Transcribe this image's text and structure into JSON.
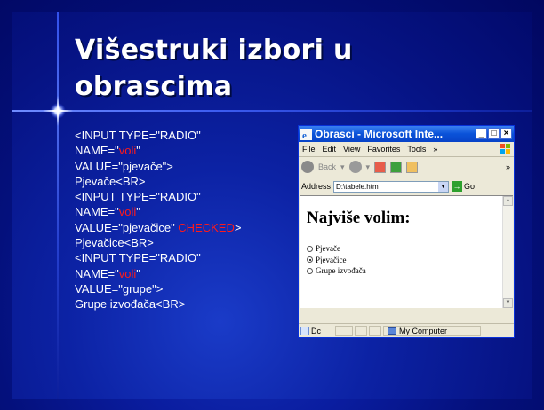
{
  "slide": {
    "title_line1": "Višestruki izbori u",
    "title_line2": "obrascima",
    "code_lines": [
      [
        {
          "t": "<INPUT TYPE=\"RADIO\""
        }
      ],
      [
        {
          "t": "NAME=\""
        },
        {
          "t": "voli",
          "red": true
        },
        {
          "t": "\""
        }
      ],
      [
        {
          "t": "VALUE=\"pjevače\">"
        }
      ],
      [
        {
          "t": "Pjevače<BR>"
        }
      ],
      [
        {
          "t": "<INPUT TYPE=\"RADIO\""
        }
      ],
      [
        {
          "t": "NAME=\""
        },
        {
          "t": "voli",
          "red": true
        },
        {
          "t": "\""
        }
      ],
      [
        {
          "t": "VALUE=\"pjevačice\" "
        },
        {
          "t": "CHECKED",
          "red": true
        },
        {
          "t": ">"
        }
      ],
      [
        {
          "t": "Pjevačice<BR>"
        }
      ],
      [
        {
          "t": "<INPUT TYPE=\"RADIO\""
        }
      ],
      [
        {
          "t": "NAME=\""
        },
        {
          "t": "voli",
          "red": true
        },
        {
          "t": "\""
        }
      ],
      [
        {
          "t": "VALUE=\"grupe\">"
        }
      ],
      [
        {
          "t": "Grupe izvođača<BR>"
        }
      ]
    ]
  },
  "browser": {
    "window_title": "Obrasci - Microsoft Inte...",
    "menu": [
      "File",
      "Edit",
      "View",
      "Favorites",
      "Tools"
    ],
    "menu_overflow": "»",
    "back_label": "Back",
    "toolbar_overflow": "»",
    "address_label": "Address",
    "address_value": "D:\\tabele.htm",
    "go_label": "Go",
    "page_heading": "Najviše volim:",
    "options": [
      {
        "label": "Pjevače",
        "checked": false
      },
      {
        "label": "Pjevačice",
        "checked": true
      },
      {
        "label": "Grupe izvođača",
        "checked": false
      }
    ],
    "status_left": "Dc",
    "status_zone": "My Computer"
  }
}
